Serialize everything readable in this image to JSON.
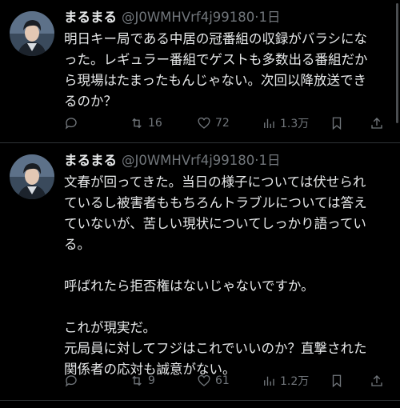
{
  "tweets": [
    {
      "display_name": "まるまる",
      "handle": "@J0WMHVrf4j99180",
      "separator": "·",
      "time": "1日",
      "text": "明日キー局である中居の冠番組の収録がバラシにな\nった。レギュラー番組でゲストも多数出る番組だか\nら現場はたまったもんじゃない。次回以降放送でき\nるのか？",
      "reply_count": "",
      "retweet_count": "16",
      "like_count": "72",
      "view_count": "1.3万"
    },
    {
      "display_name": "まるまる",
      "handle": "@J0WMHVrf4j99180",
      "separator": "·",
      "time": "1日",
      "text": "文春が回ってきた。当日の様子については伏せられ\nているし被害者ももちろんトラブルについては答え\nていないが、苦しい現状についてしっかり語ってい\nる。\n\n呼ばれたら拒否権はないじゃないですか。\n\nこれが現実だ。\n元局員に対してフジはこれでいいのか？直撃された\n関係者の応対も誠意がない。",
      "reply_count": "",
      "retweet_count": "9",
      "like_count": "61",
      "view_count": "1.2万"
    }
  ],
  "icons": {
    "reply": "reply-icon",
    "retweet": "retweet-icon",
    "like": "like-icon",
    "views": "views-icon",
    "bookmark": "bookmark-icon",
    "share": "share-icon"
  },
  "colors": {
    "background": "#000000",
    "text": "#e7e9ea",
    "secondary": "#71767b",
    "divider": "#2f3336"
  }
}
